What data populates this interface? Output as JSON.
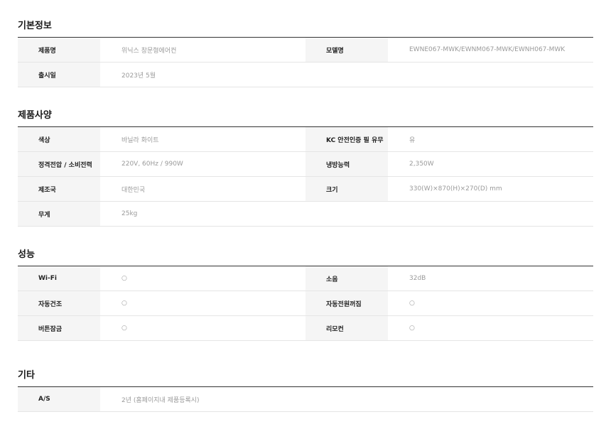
{
  "sections": [
    {
      "title": "기본정보",
      "rows": [
        [
          {
            "label": "제품명",
            "value": "위닉스 창문형에어컨"
          },
          {
            "label": "모델명",
            "value": "EWNE067-MWK/EWNM067-MWK/EWNH067-MWK"
          }
        ],
        [
          {
            "label": "출시일",
            "value": "2023년 5월"
          }
        ]
      ]
    },
    {
      "title": "제품사양",
      "rows": [
        [
          {
            "label": "색상",
            "value": "바닐라 화이트"
          },
          {
            "label": "KC 안전인증 필 유무",
            "value": "유"
          }
        ],
        [
          {
            "label": "정격전압 / 소비전력",
            "value": "220V, 60Hz / 990W"
          },
          {
            "label": "냉방능력",
            "value": "2,350W"
          }
        ],
        [
          {
            "label": "제조국",
            "value": "대한민국"
          },
          {
            "label": "크기",
            "value": "330(W)×870(H)×270(D) mm"
          }
        ],
        [
          {
            "label": "무게",
            "value": "25kg"
          }
        ]
      ]
    },
    {
      "title": "성능",
      "rows": [
        [
          {
            "label": "Wi-Fi",
            "value": "○"
          },
          {
            "label": "소음",
            "value": "32dB"
          }
        ],
        [
          {
            "label": "자동건조",
            "value": "○"
          },
          {
            "label": "자동전원꺼짐",
            "value": "○"
          }
        ],
        [
          {
            "label": "버튼잠금",
            "value": "○"
          },
          {
            "label": "리모컨",
            "value": "○"
          }
        ]
      ]
    },
    {
      "title": "기타",
      "rows": [
        [
          {
            "label": "A/S",
            "value": "2년 (홈페이지내 제품등록시)"
          }
        ]
      ]
    }
  ]
}
